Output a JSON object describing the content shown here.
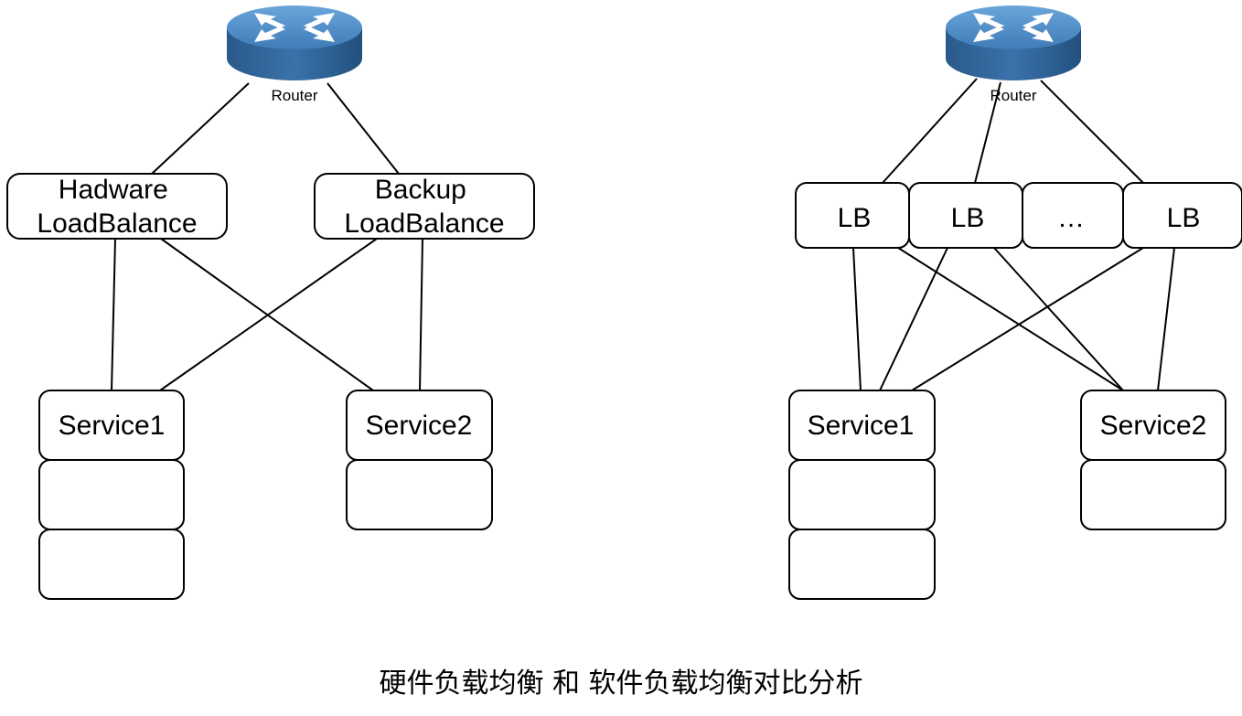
{
  "colors": {
    "router_top": "#4f8fc8",
    "router_side": "#2b5e91",
    "router_arrows": "#ffffff",
    "line": "#000000",
    "box_fill": "#ffffff"
  },
  "icons": [
    "router-icon"
  ],
  "left": {
    "router_label": "Router",
    "lb_primary": [
      "Hadware",
      "LoadBalance"
    ],
    "lb_backup": [
      "Backup",
      "LoadBalance"
    ],
    "service1": "Service1",
    "service2": "Service2"
  },
  "right": {
    "router_label": "Router",
    "lb_boxes": [
      "LB",
      "LB",
      "…",
      "LB"
    ],
    "service1": "Service1",
    "service2": "Service2"
  },
  "caption": "硬件负载均衡 和 软件负载均衡对比分析"
}
